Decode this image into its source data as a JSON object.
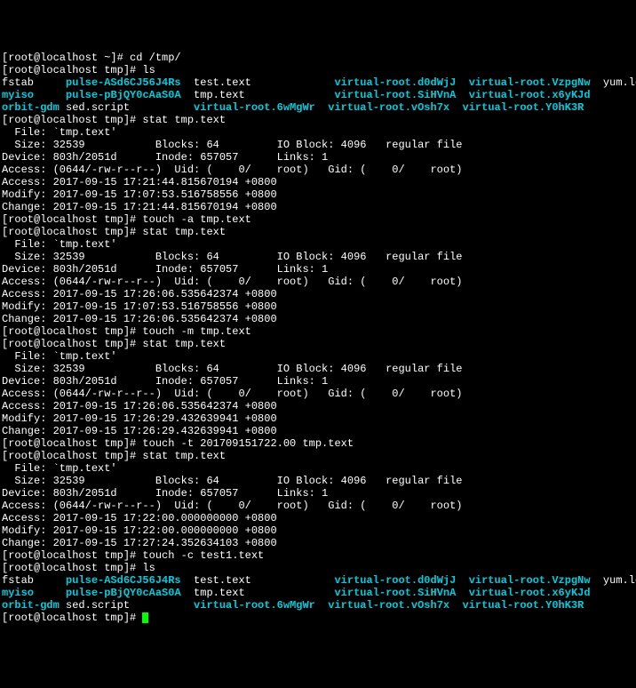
{
  "lines": {
    "l1": "[root@localhost ~]# cd /tmp/",
    "l2": "[root@localhost tmp]# ls",
    "l3a": "fstab     ",
    "l3b": "pulse-ASd6CJ56J4Rs",
    "l3c": "  test.text             ",
    "l3d": "virtual-root.d0dWjJ",
    "l3e": "  ",
    "l3f": "virtual-root.VzpgNw",
    "l3g": "  yum.log",
    "l4a": "myiso",
    "l4b": "     ",
    "l4c": "pulse-pBjQY0cAaS0A",
    "l4d": "  tmp.text              ",
    "l4e": "virtual-root.SiHVnA",
    "l4f": "  ",
    "l4g": "virtual-root.x6yKJd",
    "l5a": "orbit-gdm",
    "l5b": " sed.script          ",
    "l5c": "virtual-root.6wMgWr",
    "l5d": "  ",
    "l5e": "virtual-root.vOsh7x",
    "l5f": "  ",
    "l5g": "virtual-root.Y0hK3R",
    "l6": "[root@localhost tmp]# stat tmp.text",
    "l7": "  File: `tmp.text'",
    "l8": "  Size: 32539           Blocks: 64         IO Block: 4096   regular file",
    "l9": "Device: 803h/2051d      Inode: 657057      Links: 1",
    "l10": "Access: (0644/-rw-r--r--)  Uid: (    0/    root)   Gid: (    0/    root)",
    "l11": "Access: 2017-09-15 17:21:44.815670194 +0800",
    "l12": "Modify: 2017-09-15 17:07:53.516758556 +0800",
    "l13": "Change: 2017-09-15 17:21:44.815670194 +0800",
    "l14": "[root@localhost tmp]# touch -a tmp.text",
    "l15": "[root@localhost tmp]# stat tmp.text",
    "l16": "  File: `tmp.text'",
    "l17": "  Size: 32539           Blocks: 64         IO Block: 4096   regular file",
    "l18": "Device: 803h/2051d      Inode: 657057      Links: 1",
    "l19": "Access: (0644/-rw-r--r--)  Uid: (    0/    root)   Gid: (    0/    root)",
    "l20": "Access: 2017-09-15 17:26:06.535642374 +0800",
    "l21": "Modify: 2017-09-15 17:07:53.516758556 +0800",
    "l22": "Change: 2017-09-15 17:26:06.535642374 +0800",
    "l23": "[root@localhost tmp]# touch -m tmp.text",
    "l24": "[root@localhost tmp]# stat tmp.text",
    "l25": "  File: `tmp.text'",
    "l26": "  Size: 32539           Blocks: 64         IO Block: 4096   regular file",
    "l27": "Device: 803h/2051d      Inode: 657057      Links: 1",
    "l28": "Access: (0644/-rw-r--r--)  Uid: (    0/    root)   Gid: (    0/    root)",
    "l29": "Access: 2017-09-15 17:26:06.535642374 +0800",
    "l30": "Modify: 2017-09-15 17:26:29.432639941 +0800",
    "l31": "Change: 2017-09-15 17:26:29.432639941 +0800",
    "l32": "[root@localhost tmp]# touch -t 201709151722.00 tmp.text",
    "l33": "[root@localhost tmp]# stat tmp.text",
    "l34": "  File: `tmp.text'",
    "l35": "  Size: 32539           Blocks: 64         IO Block: 4096   regular file",
    "l36": "Device: 803h/2051d      Inode: 657057      Links: 1",
    "l37": "Access: (0644/-rw-r--r--)  Uid: (    0/    root)   Gid: (    0/    root)",
    "l38": "Access: 2017-09-15 17:22:00.000000000 +0800",
    "l39": "Modify: 2017-09-15 17:22:00.000000000 +0800",
    "l40": "Change: 2017-09-15 17:27:24.352634103 +0800",
    "l41": "[root@localhost tmp]# touch -c test1.text",
    "l42": "[root@localhost tmp]# ls",
    "l43a": "fstab     ",
    "l43b": "pulse-ASd6CJ56J4Rs",
    "l43c": "  test.text             ",
    "l43d": "virtual-root.d0dWjJ",
    "l43e": "  ",
    "l43f": "virtual-root.VzpgNw",
    "l43g": "  yum.log",
    "l44a": "myiso",
    "l44b": "     ",
    "l44c": "pulse-pBjQY0cAaS0A",
    "l44d": "  tmp.text              ",
    "l44e": "virtual-root.SiHVnA",
    "l44f": "  ",
    "l44g": "virtual-root.x6yKJd",
    "l45a": "orbit-gdm",
    "l45b": " sed.script          ",
    "l45c": "virtual-root.6wMgWr",
    "l45d": "  ",
    "l45e": "virtual-root.vOsh7x",
    "l45f": "  ",
    "l45g": "virtual-root.Y0hK3R",
    "l46": "[root@localhost tmp]# "
  }
}
